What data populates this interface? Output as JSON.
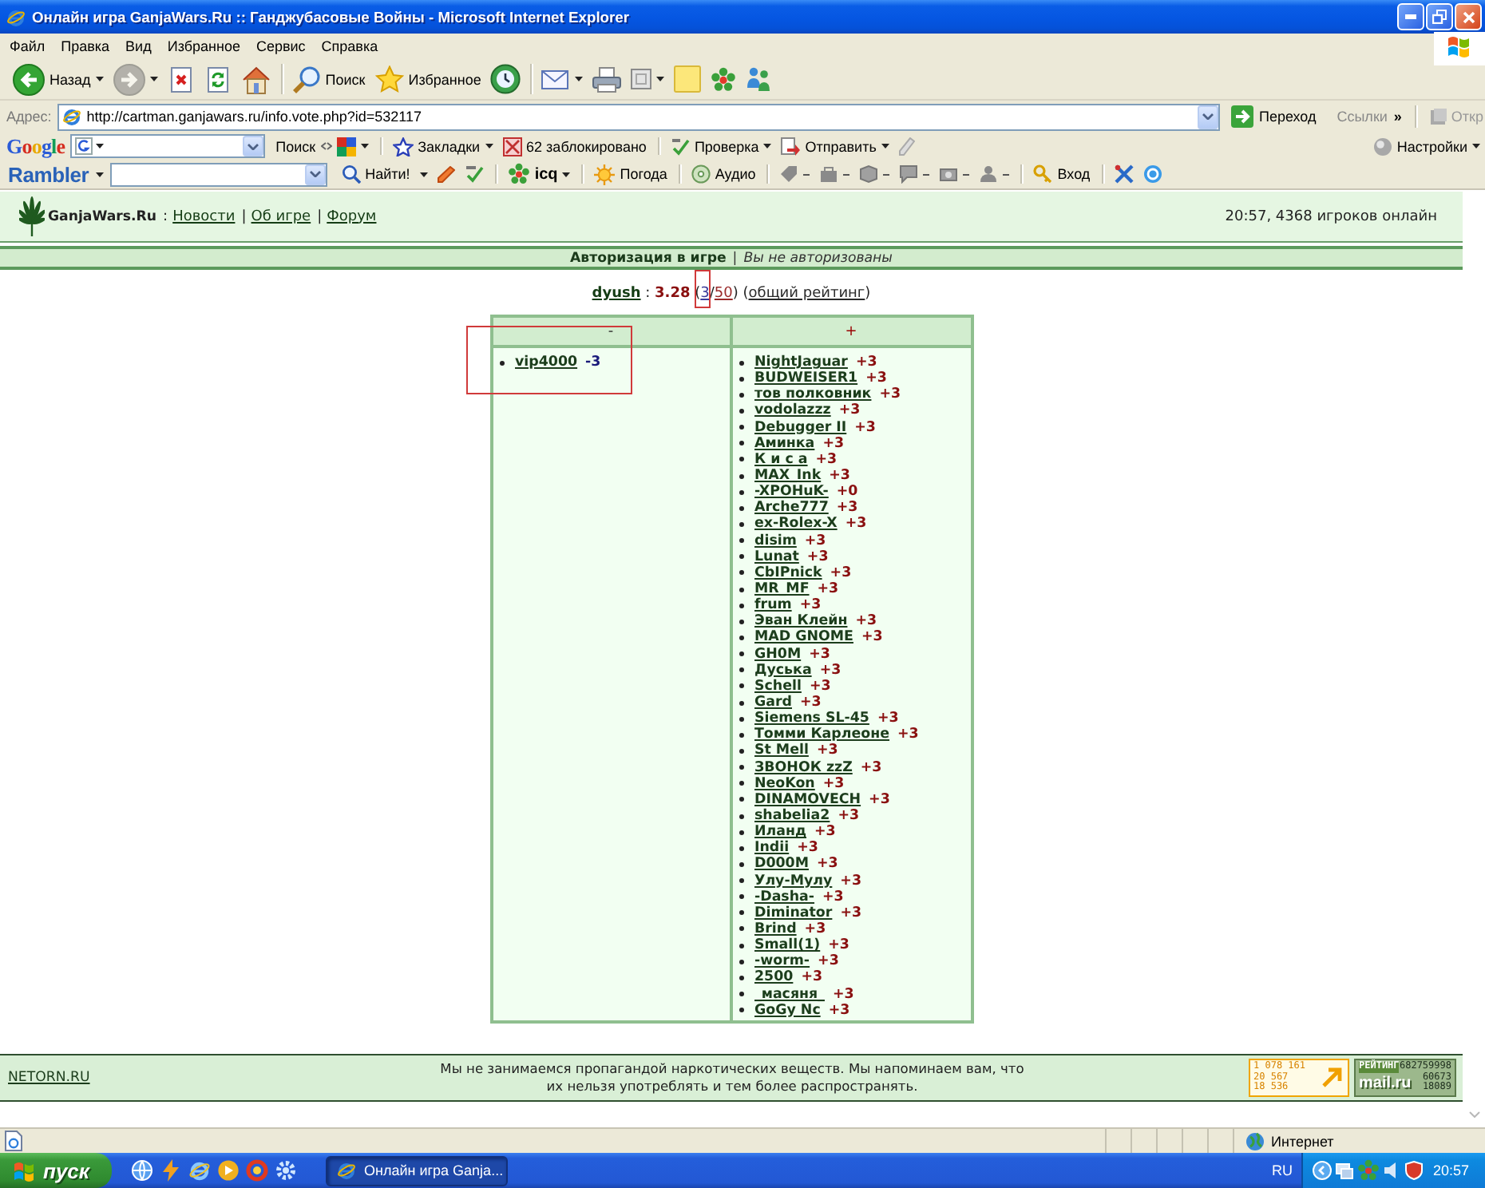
{
  "window": {
    "title": "Онлайн игра GanjaWars.Ru :: Ганджубасовые Войны - Microsoft Internet Explorer"
  },
  "menu_bar": [
    "Файл",
    "Правка",
    "Вид",
    "Избранное",
    "Сервис",
    "Справка"
  ],
  "toolbar": [
    {
      "kind": "back",
      "label": "Назад",
      "dropdown": true,
      "disabled": false
    },
    {
      "kind": "forward",
      "dropdown": true,
      "disabled": true
    },
    {
      "kind": "stop",
      "dropdown": false,
      "disabled": false
    },
    {
      "kind": "refresh",
      "dropdown": false,
      "disabled": false
    },
    {
      "kind": "home",
      "dropdown": false,
      "disabled": false
    },
    {
      "kind": "separator"
    },
    {
      "kind": "search",
      "label": "Поиск",
      "dropdown": false,
      "disabled": false
    },
    {
      "kind": "favorites",
      "label": "Избранное",
      "dropdown": false,
      "disabled": false
    },
    {
      "kind": "history",
      "dropdown": false,
      "disabled": false
    },
    {
      "kind": "separator"
    },
    {
      "kind": "mail",
      "dropdown": true,
      "disabled": false
    },
    {
      "kind": "print",
      "dropdown": false,
      "disabled": false
    },
    {
      "kind": "edit",
      "dropdown": true,
      "disabled": false
    },
    {
      "kind": "notes",
      "dropdown": false,
      "disabled": false
    },
    {
      "kind": "icq",
      "dropdown": false,
      "disabled": false
    },
    {
      "kind": "messenger",
      "dropdown": false,
      "disabled": false
    }
  ],
  "address_bar": {
    "label": "Адрес:",
    "url": "http://cartman.ganjawars.ru/info.vote.php?id=532117",
    "go_button": "Переход",
    "links_label": "Ссылки",
    "more": "»",
    "cut_button": "Откр"
  },
  "google_toolbar": {
    "logo": "Google",
    "search_button": "Поиск",
    "bookmarks": "Закладки",
    "blocked": "62 заблокировано",
    "spellcheck": "Проверка",
    "send": "Отправить",
    "settings": "Настройки"
  },
  "rambler_toolbar": {
    "logo": "Rambler",
    "find_button": "Найти!",
    "icq": "icq",
    "weather": "Погода",
    "audio": "Аудио",
    "login": "Вход"
  },
  "site_header": {
    "site_name": "GanjaWars.Ru",
    "nav": [
      {
        "kind": "separator",
        "text": ":"
      },
      {
        "kind": "link",
        "text": "Новости"
      },
      {
        "kind": "separator",
        "text": "|"
      },
      {
        "kind": "link",
        "text": "Об игре"
      },
      {
        "kind": "separator",
        "text": "|"
      },
      {
        "kind": "link",
        "text": "Форум"
      }
    ],
    "online": "20:57, 4368 игроков онлайн"
  },
  "auth_bar": {
    "title": "Авторизация в игре",
    "separator": "|",
    "status": "Вы не авторизованы"
  },
  "rating_line": [
    {
      "kind": "player",
      "text": "dyush"
    },
    {
      "kind": "plain",
      "text": " : "
    },
    {
      "kind": "score",
      "text": "3.28"
    },
    {
      "kind": "plain",
      "text": " ("
    },
    {
      "kind": "link",
      "text": "3",
      "color": "#3a3a9a",
      "marked": true
    },
    {
      "kind": "plain",
      "text": "/"
    },
    {
      "kind": "link",
      "text": "50",
      "color": "#9a2a2a",
      "marked": false
    },
    {
      "kind": "plain",
      "text": ") ("
    },
    {
      "kind": "link",
      "text": "общий рейтинг",
      "color": "#2a2a2a",
      "marked": false
    },
    {
      "kind": "plain",
      "text": ")"
    }
  ],
  "votes_table": {
    "columns": [
      {
        "kind": "minus",
        "heading": "-",
        "voters": [
          {
            "name": "vip4000",
            "score": "-3",
            "marked": true
          }
        ]
      },
      {
        "kind": "plus",
        "heading": "+",
        "voters": [
          {
            "name": "NightJaguar",
            "score": "+3",
            "marked": false
          },
          {
            "name": "BUDWEISER1",
            "score": "+3",
            "marked": false
          },
          {
            "name": "тов полковник",
            "score": "+3",
            "marked": false
          },
          {
            "name": "vodolazzz",
            "score": "+3",
            "marked": false
          },
          {
            "name": "Debugger II",
            "score": "+3",
            "marked": false
          },
          {
            "name": "Аминка",
            "score": "+3",
            "marked": false
          },
          {
            "name": "К и с а",
            "score": "+3",
            "marked": false
          },
          {
            "name": "MAX_Ink",
            "score": "+3",
            "marked": false
          },
          {
            "name": "-XPOHuK-",
            "score": "+0",
            "marked": false
          },
          {
            "name": "Arche777",
            "score": "+3",
            "marked": false
          },
          {
            "name": "ex-Rolex-X",
            "score": "+3",
            "marked": false
          },
          {
            "name": "disim",
            "score": "+3",
            "marked": false
          },
          {
            "name": "Lunat",
            "score": "+3",
            "marked": false
          },
          {
            "name": "CbIPnick",
            "score": "+3",
            "marked": false
          },
          {
            "name": "MR_MF",
            "score": "+3",
            "marked": false
          },
          {
            "name": "frum",
            "score": "+3",
            "marked": false
          },
          {
            "name": "Эван Клейн",
            "score": "+3",
            "marked": false
          },
          {
            "name": "MAD GNOME",
            "score": "+3",
            "marked": false
          },
          {
            "name": "GH0M",
            "score": "+3",
            "marked": false
          },
          {
            "name": "Дуська",
            "score": "+3",
            "marked": false
          },
          {
            "name": "Schell",
            "score": "+3",
            "marked": false
          },
          {
            "name": "Gard",
            "score": "+3",
            "marked": false
          },
          {
            "name": "Siemens SL-45",
            "score": "+3",
            "marked": false
          },
          {
            "name": "Томми Карлеоне",
            "score": "+3",
            "marked": false
          },
          {
            "name": "St Mell",
            "score": "+3",
            "marked": false
          },
          {
            "name": "ЗВОНОК zzZ",
            "score": "+3",
            "marked": false
          },
          {
            "name": "NeoKon",
            "score": "+3",
            "marked": false
          },
          {
            "name": "DINAMOVECH",
            "score": "+3",
            "marked": false
          },
          {
            "name": "shabelia2",
            "score": "+3",
            "marked": false
          },
          {
            "name": "Иланд",
            "score": "+3",
            "marked": false
          },
          {
            "name": "Indii",
            "score": "+3",
            "marked": false
          },
          {
            "name": "D000M",
            "score": "+3",
            "marked": false
          },
          {
            "name": "Улу-Мулу",
            "score": "+3",
            "marked": false
          },
          {
            "name": "-Dasha-",
            "score": "+3",
            "marked": false
          },
          {
            "name": "Diminator",
            "score": "+3",
            "marked": false
          },
          {
            "name": "Brind",
            "score": "+3",
            "marked": false
          },
          {
            "name": "Small(1)",
            "score": "+3",
            "marked": false
          },
          {
            "name": "-worm-",
            "score": "+3",
            "marked": false
          },
          {
            "name": "2500",
            "score": "+3",
            "marked": false
          },
          {
            "name": "_масяня_",
            "score": "+3",
            "marked": false
          },
          {
            "name": "GoGy Nc",
            "score": "+3",
            "marked": false
          }
        ]
      }
    ]
  },
  "footer": {
    "link": "NETORN.RU",
    "notice": "Мы не занимаемся пропагандой наркотических веществ. Мы напоминаем вам, что их нельзя употреблять и тем более распространять.",
    "counters": [
      {
        "kind": "arrow",
        "lines": [
          "1 078 161",
          "20 567",
          "18 536"
        ]
      },
      {
        "kind": "rating",
        "label": "РЕЙТИНГ",
        "total": "682759998",
        "logo": "mail.ru",
        "lines": [
          "60673",
          "18089"
        ]
      }
    ]
  },
  "status_bar": {
    "zone": "Интернет"
  },
  "taskbar": {
    "start": "пуск",
    "tasks": [
      {
        "title": "Онлайн игра Ganja...",
        "selected": true
      }
    ],
    "language": "RU",
    "clock": "20:57"
  }
}
